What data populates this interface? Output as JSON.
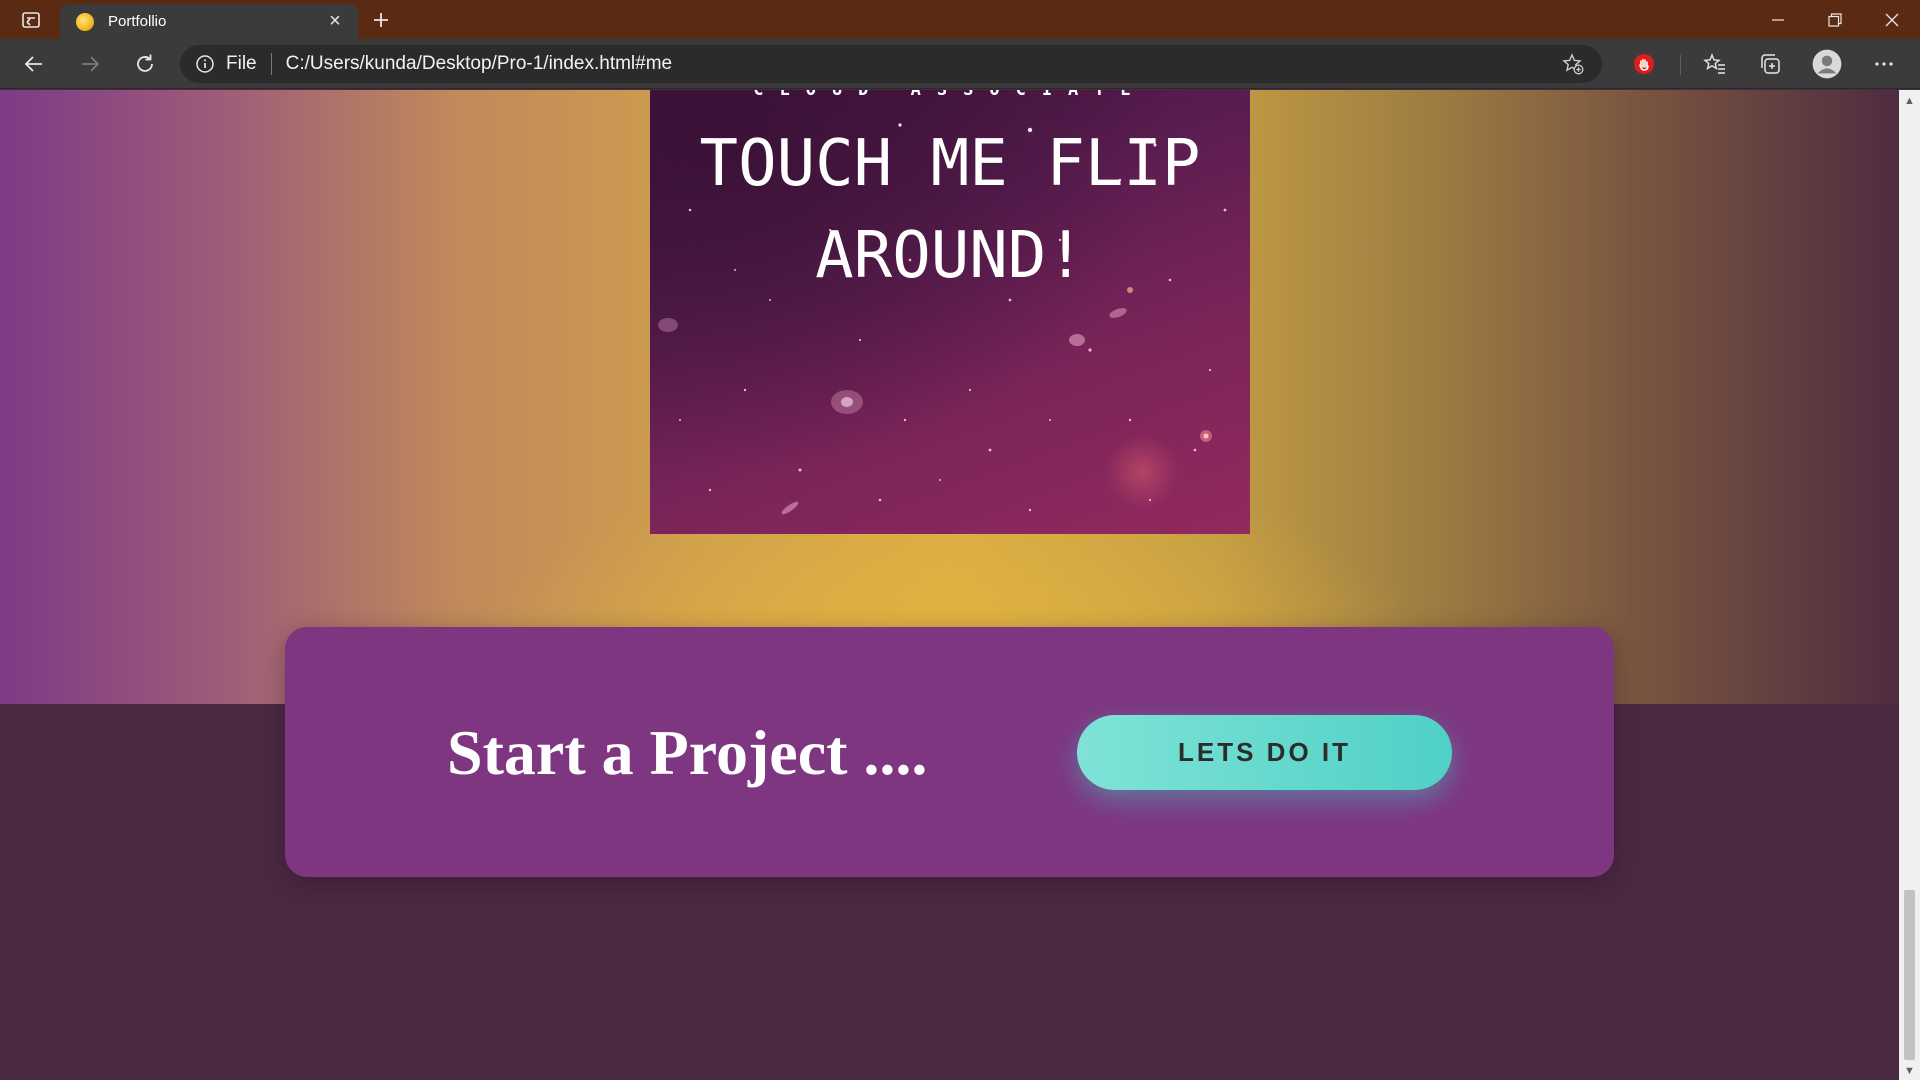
{
  "browser": {
    "tab_title": "Portfollio",
    "tab_close": "×",
    "address_scheme": "File",
    "address_url": "C:/Users/kunda/Desktop/Pro-1/index.html#me",
    "theme_color": "#5a2a12"
  },
  "page": {
    "card": {
      "subtitle": "CLOUD ASSOCIATE",
      "title": "TOUCH ME FLIP AROUND!"
    },
    "cta": {
      "heading": "Start a Project ....",
      "button_label": "LETS DO IT",
      "panel_color": "#7e3680",
      "button_color": "#5fd8cc"
    },
    "background_color": "#4a2942"
  },
  "icons": {
    "tab_actions": "tab-actions-icon",
    "new_tab": "plus-icon",
    "back": "arrow-left-icon",
    "forward": "arrow-right-icon",
    "refresh": "refresh-icon",
    "site_info": "info-icon",
    "add_favorite": "star-plus-icon",
    "extension": "hand-stop-icon",
    "favorites": "favorites-list-icon",
    "collections": "collections-icon",
    "profile": "profile-icon",
    "more": "ellipsis-icon"
  }
}
